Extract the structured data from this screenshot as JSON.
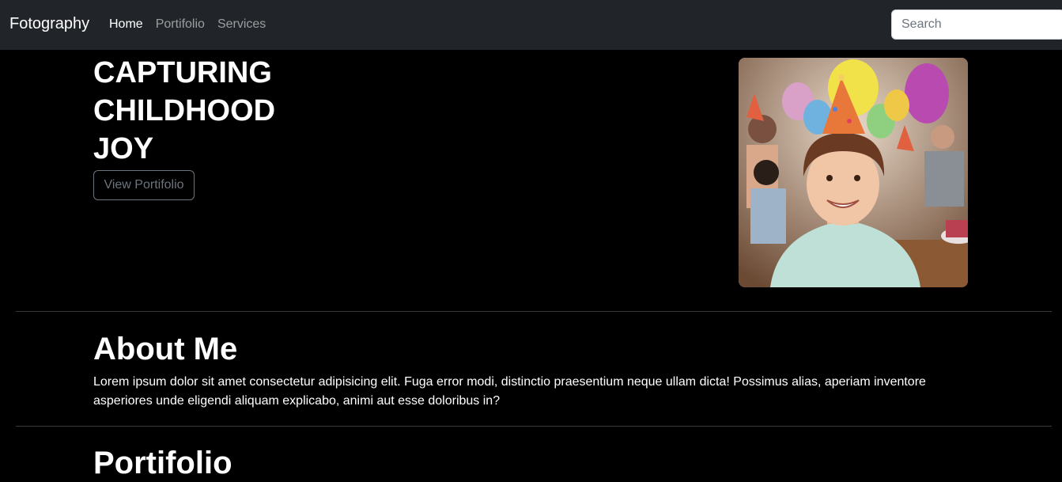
{
  "navbar": {
    "brand": "Fotography",
    "links": [
      {
        "label": "Home",
        "active": true
      },
      {
        "label": "Portifolio",
        "active": false
      },
      {
        "label": "Services",
        "active": false
      }
    ],
    "search_placeholder": "Search"
  },
  "hero": {
    "title_lines": [
      "CAPTURING",
      "CHILDHOOD",
      "JOY"
    ],
    "button_label": "View Portifolio",
    "image_description_icon": "child-birthday-party-photo"
  },
  "about": {
    "title": "About Me",
    "text": "Lorem ipsum dolor sit amet consectetur adipisicing elit. Fuga error modi, distinctio praesentium neque ullam dicta! Possimus alias, aperiam inventore asperiores unde eligendi aliquam explicabo, animi aut esse doloribus in?"
  },
  "portfolio": {
    "title": "Portifolio"
  },
  "colors": {
    "navbar_bg": "#212529",
    "page_bg": "#000000",
    "muted": "#6c757d"
  }
}
